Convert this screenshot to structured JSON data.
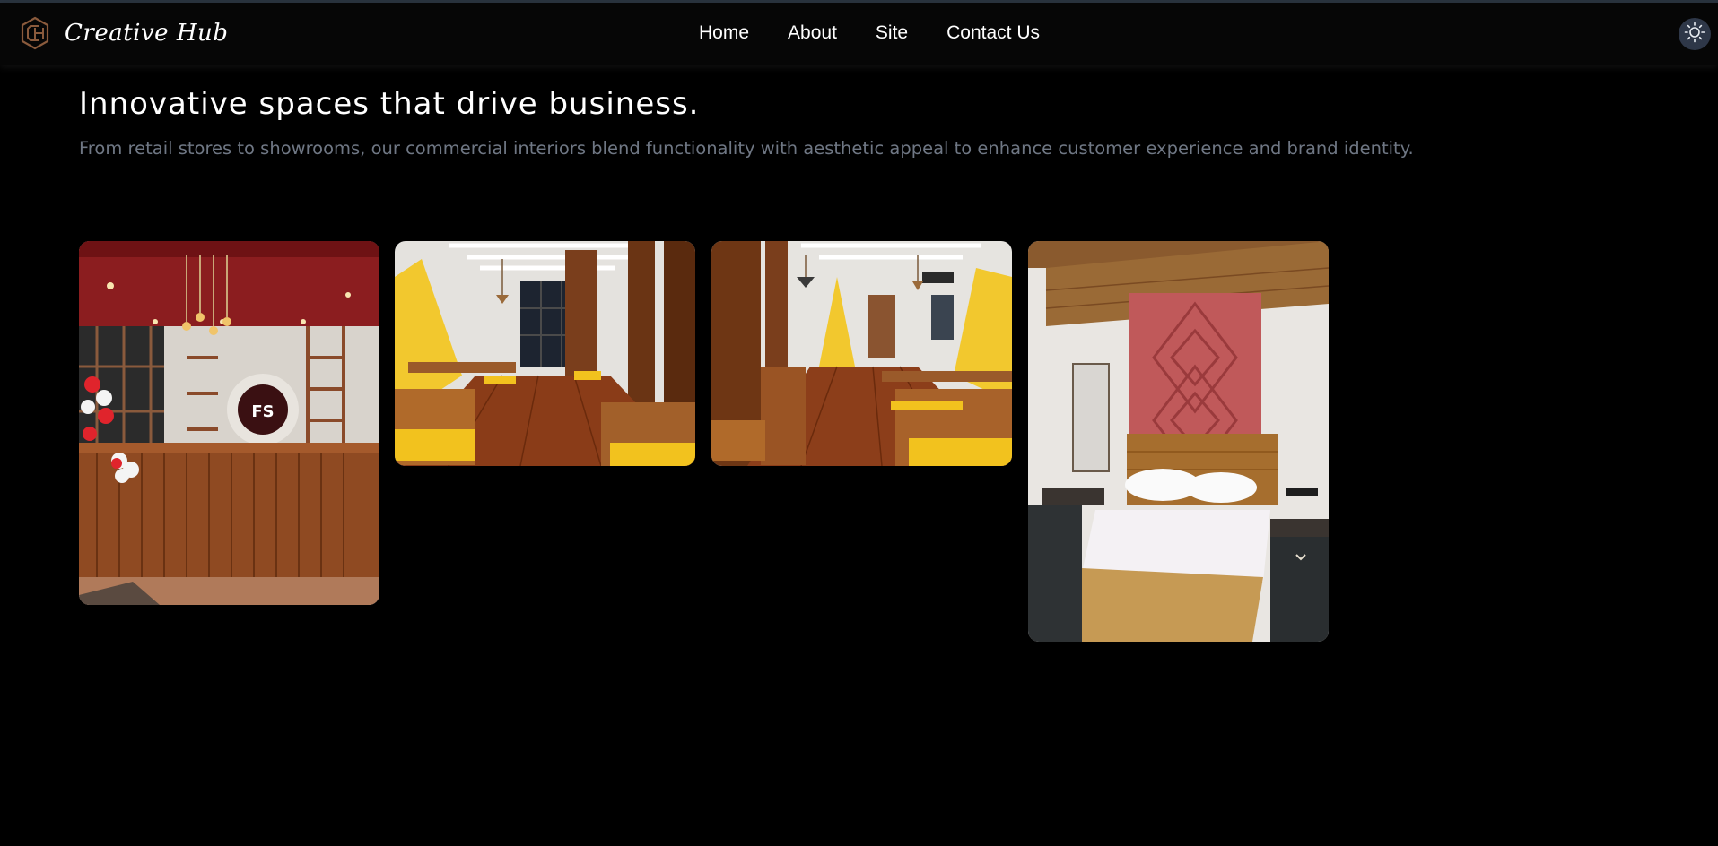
{
  "app": {
    "brand": "Creative Hub",
    "logo_icon": "hexagon-logo-icon"
  },
  "nav": {
    "items": [
      {
        "label": "Home"
      },
      {
        "label": "About"
      },
      {
        "label": "Site"
      },
      {
        "label": "Contact Us"
      }
    ]
  },
  "theme_toggle": {
    "icon": "sun-icon"
  },
  "hero": {
    "title": "Innovative spaces that drive business.",
    "subtitle": "From retail stores to showrooms, our commercial interiors blend functionality with aesthetic appeal to enhance customer experience and brand identity."
  },
  "gallery": {
    "items": [
      {
        "subject": "cafe-counter-photo",
        "sign_text": "FS"
      },
      {
        "subject": "restaurant-dining-photo-1"
      },
      {
        "subject": "restaurant-dining-photo-2"
      },
      {
        "subject": "hotel-bedroom-photo"
      }
    ]
  },
  "colors": {
    "background": "#000000",
    "header": "#060606",
    "text": "#ffffff",
    "muted_text": "#6f7784",
    "toggle_bg": "#2e3748",
    "logo_accent": "#8a5a3c"
  }
}
